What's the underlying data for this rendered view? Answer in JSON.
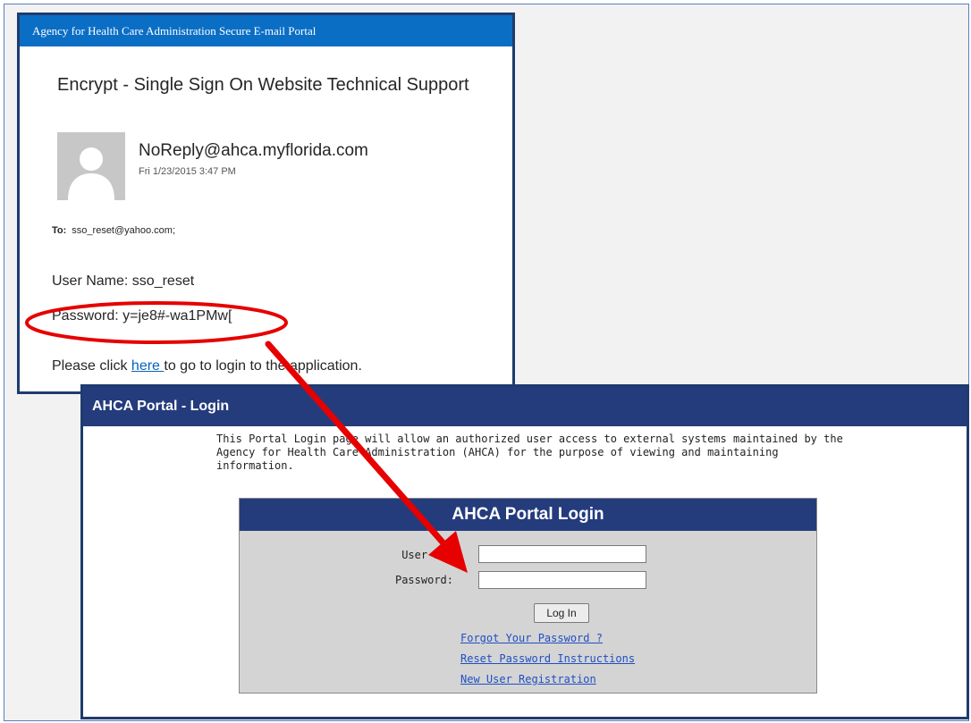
{
  "email": {
    "header_title": "Agency for Health Care Administration Secure E-mail Portal",
    "subject": "Encrypt - Single Sign On Website Technical Support",
    "sender": "NoReply@ahca.myflorida.com",
    "sent_time": "Fri 1/23/2015 3:47 PM",
    "to_label": "To:",
    "to_value": "sso_reset@yahoo.com;",
    "username_line": "User Name: sso_reset",
    "password_line": "Password: y=je8#-wa1PMw[",
    "click_prefix": "Please click ",
    "click_link": "here ",
    "click_suffix": "to go to login to the application."
  },
  "portal": {
    "header_title": "AHCA Portal - Login",
    "intro_lines": [
      "This Portal Login page will allow an authorized user access to external systems maintained by the",
      "Agency for Health Care Administration (AHCA) for the purpose of viewing and maintaining",
      "information."
    ],
    "login_title": "AHCA Portal Login",
    "user_id_label": "User ID:",
    "password_label": "Password:",
    "user_id_value": "",
    "password_value": "",
    "login_button": "Log In",
    "links": {
      "forgot": "Forgot Your Password ?",
      "reset": "Reset Password Instructions",
      "register": "New User Registration"
    }
  },
  "annotation": {
    "color": "#e60000"
  }
}
